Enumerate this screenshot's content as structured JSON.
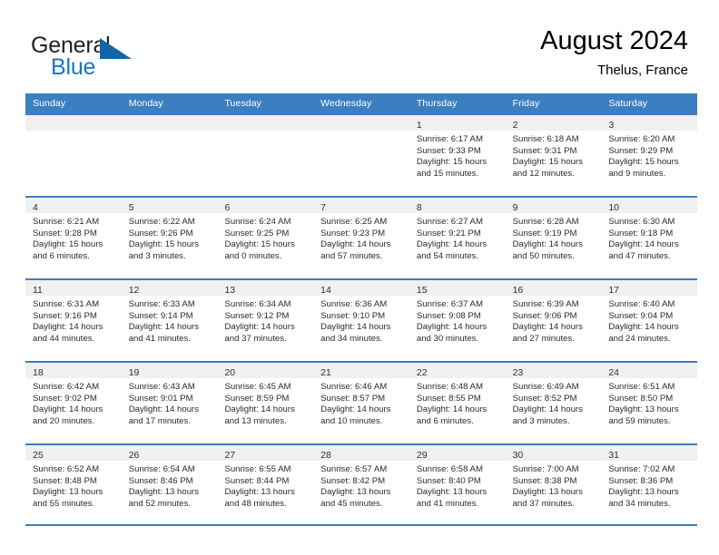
{
  "brand": {
    "name_part1": "General",
    "name_part2": "Blue",
    "triangle_color": "#1165a8",
    "blue_color": "#1878be"
  },
  "header": {
    "title": "August 2024",
    "subtitle": "Thelus, France"
  },
  "theme": {
    "header_band": "#3c7fc1",
    "date_band": "#f0f0f0",
    "text": "#2b2b2b"
  },
  "weekdays": [
    "Sunday",
    "Monday",
    "Tuesday",
    "Wednesday",
    "Thursday",
    "Friday",
    "Saturday"
  ],
  "weeks": [
    [
      {
        "date": "",
        "lines": []
      },
      {
        "date": "",
        "lines": []
      },
      {
        "date": "",
        "lines": []
      },
      {
        "date": "",
        "lines": []
      },
      {
        "date": "1",
        "lines": [
          "Sunrise: 6:17 AM",
          "Sunset: 9:33 PM",
          "Daylight: 15 hours",
          "and 15 minutes."
        ]
      },
      {
        "date": "2",
        "lines": [
          "Sunrise: 6:18 AM",
          "Sunset: 9:31 PM",
          "Daylight: 15 hours",
          "and 12 minutes."
        ]
      },
      {
        "date": "3",
        "lines": [
          "Sunrise: 6:20 AM",
          "Sunset: 9:29 PM",
          "Daylight: 15 hours",
          "and 9 minutes."
        ]
      }
    ],
    [
      {
        "date": "4",
        "lines": [
          "Sunrise: 6:21 AM",
          "Sunset: 9:28 PM",
          "Daylight: 15 hours",
          "and 6 minutes."
        ]
      },
      {
        "date": "5",
        "lines": [
          "Sunrise: 6:22 AM",
          "Sunset: 9:26 PM",
          "Daylight: 15 hours",
          "and 3 minutes."
        ]
      },
      {
        "date": "6",
        "lines": [
          "Sunrise: 6:24 AM",
          "Sunset: 9:25 PM",
          "Daylight: 15 hours",
          "and 0 minutes."
        ]
      },
      {
        "date": "7",
        "lines": [
          "Sunrise: 6:25 AM",
          "Sunset: 9:23 PM",
          "Daylight: 14 hours",
          "and 57 minutes."
        ]
      },
      {
        "date": "8",
        "lines": [
          "Sunrise: 6:27 AM",
          "Sunset: 9:21 PM",
          "Daylight: 14 hours",
          "and 54 minutes."
        ]
      },
      {
        "date": "9",
        "lines": [
          "Sunrise: 6:28 AM",
          "Sunset: 9:19 PM",
          "Daylight: 14 hours",
          "and 50 minutes."
        ]
      },
      {
        "date": "10",
        "lines": [
          "Sunrise: 6:30 AM",
          "Sunset: 9:18 PM",
          "Daylight: 14 hours",
          "and 47 minutes."
        ]
      }
    ],
    [
      {
        "date": "11",
        "lines": [
          "Sunrise: 6:31 AM",
          "Sunset: 9:16 PM",
          "Daylight: 14 hours",
          "and 44 minutes."
        ]
      },
      {
        "date": "12",
        "lines": [
          "Sunrise: 6:33 AM",
          "Sunset: 9:14 PM",
          "Daylight: 14 hours",
          "and 41 minutes."
        ]
      },
      {
        "date": "13",
        "lines": [
          "Sunrise: 6:34 AM",
          "Sunset: 9:12 PM",
          "Daylight: 14 hours",
          "and 37 minutes."
        ]
      },
      {
        "date": "14",
        "lines": [
          "Sunrise: 6:36 AM",
          "Sunset: 9:10 PM",
          "Daylight: 14 hours",
          "and 34 minutes."
        ]
      },
      {
        "date": "15",
        "lines": [
          "Sunrise: 6:37 AM",
          "Sunset: 9:08 PM",
          "Daylight: 14 hours",
          "and 30 minutes."
        ]
      },
      {
        "date": "16",
        "lines": [
          "Sunrise: 6:39 AM",
          "Sunset: 9:06 PM",
          "Daylight: 14 hours",
          "and 27 minutes."
        ]
      },
      {
        "date": "17",
        "lines": [
          "Sunrise: 6:40 AM",
          "Sunset: 9:04 PM",
          "Daylight: 14 hours",
          "and 24 minutes."
        ]
      }
    ],
    [
      {
        "date": "18",
        "lines": [
          "Sunrise: 6:42 AM",
          "Sunset: 9:02 PM",
          "Daylight: 14 hours",
          "and 20 minutes."
        ]
      },
      {
        "date": "19",
        "lines": [
          "Sunrise: 6:43 AM",
          "Sunset: 9:01 PM",
          "Daylight: 14 hours",
          "and 17 minutes."
        ]
      },
      {
        "date": "20",
        "lines": [
          "Sunrise: 6:45 AM",
          "Sunset: 8:59 PM",
          "Daylight: 14 hours",
          "and 13 minutes."
        ]
      },
      {
        "date": "21",
        "lines": [
          "Sunrise: 6:46 AM",
          "Sunset: 8:57 PM",
          "Daylight: 14 hours",
          "and 10 minutes."
        ]
      },
      {
        "date": "22",
        "lines": [
          "Sunrise: 6:48 AM",
          "Sunset: 8:55 PM",
          "Daylight: 14 hours",
          "and 6 minutes."
        ]
      },
      {
        "date": "23",
        "lines": [
          "Sunrise: 6:49 AM",
          "Sunset: 8:52 PM",
          "Daylight: 14 hours",
          "and 3 minutes."
        ]
      },
      {
        "date": "24",
        "lines": [
          "Sunrise: 6:51 AM",
          "Sunset: 8:50 PM",
          "Daylight: 13 hours",
          "and 59 minutes."
        ]
      }
    ],
    [
      {
        "date": "25",
        "lines": [
          "Sunrise: 6:52 AM",
          "Sunset: 8:48 PM",
          "Daylight: 13 hours",
          "and 55 minutes."
        ]
      },
      {
        "date": "26",
        "lines": [
          "Sunrise: 6:54 AM",
          "Sunset: 8:46 PM",
          "Daylight: 13 hours",
          "and 52 minutes."
        ]
      },
      {
        "date": "27",
        "lines": [
          "Sunrise: 6:55 AM",
          "Sunset: 8:44 PM",
          "Daylight: 13 hours",
          "and 48 minutes."
        ]
      },
      {
        "date": "28",
        "lines": [
          "Sunrise: 6:57 AM",
          "Sunset: 8:42 PM",
          "Daylight: 13 hours",
          "and 45 minutes."
        ]
      },
      {
        "date": "29",
        "lines": [
          "Sunrise: 6:58 AM",
          "Sunset: 8:40 PM",
          "Daylight: 13 hours",
          "and 41 minutes."
        ]
      },
      {
        "date": "30",
        "lines": [
          "Sunrise: 7:00 AM",
          "Sunset: 8:38 PM",
          "Daylight: 13 hours",
          "and 37 minutes."
        ]
      },
      {
        "date": "31",
        "lines": [
          "Sunrise: 7:02 AM",
          "Sunset: 8:36 PM",
          "Daylight: 13 hours",
          "and 34 minutes."
        ]
      }
    ]
  ]
}
